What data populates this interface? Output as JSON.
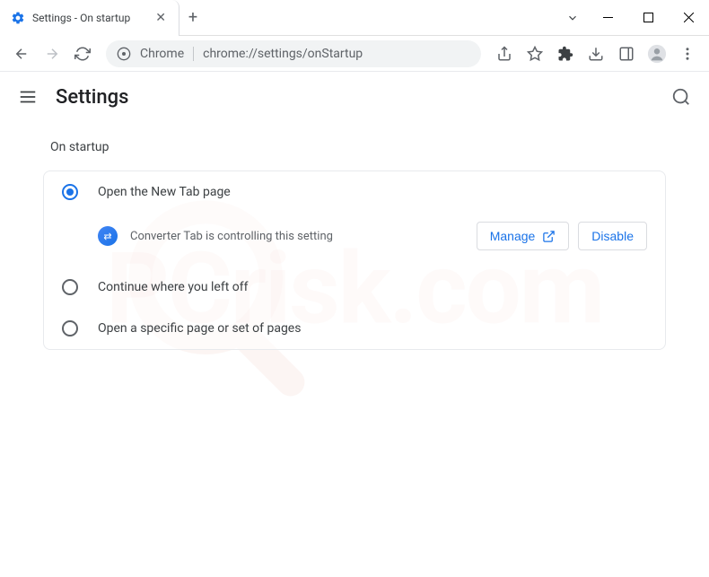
{
  "window": {
    "tab_title": "Settings - On startup"
  },
  "omnibox": {
    "scheme_label": "Chrome",
    "url": "chrome://settings/onStartup"
  },
  "header": {
    "title": "Settings"
  },
  "section": {
    "title": "On startup",
    "options": [
      {
        "label": "Open the New Tab page"
      },
      {
        "label": "Continue where you left off"
      },
      {
        "label": "Open a specific page or set of pages"
      }
    ],
    "extension_notice": "Converter Tab is controlling this setting",
    "manage_label": "Manage",
    "disable_label": "Disable"
  },
  "watermark": "PCrisk.com"
}
